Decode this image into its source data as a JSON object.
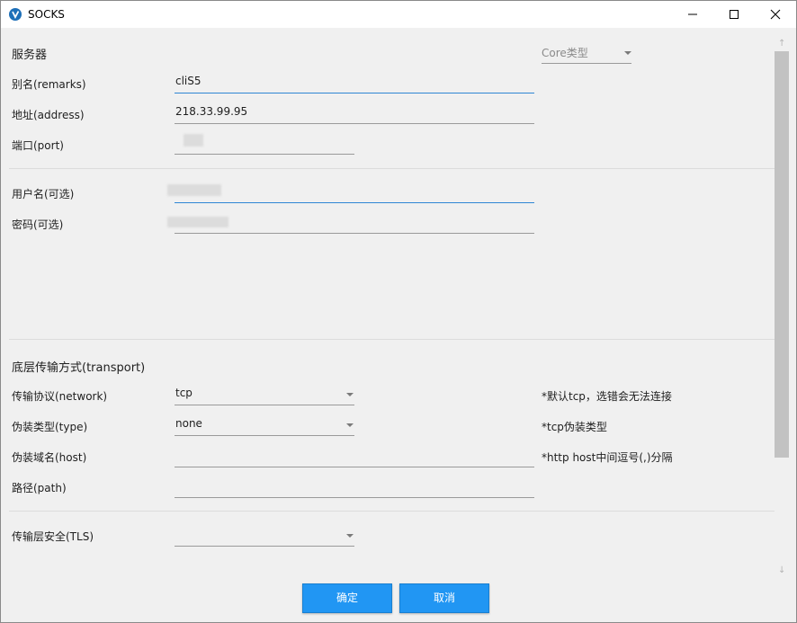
{
  "window": {
    "title": "SOCKS"
  },
  "server": {
    "section_title": "服务器",
    "core_type_placeholder": "Core类型",
    "remarks_label": "别名(remarks)",
    "remarks_value": "cliS5",
    "address_label": "地址(address)",
    "address_value": "218.33.99.95",
    "port_label": "端口(port)",
    "username_label": "用户名(可选)",
    "password_label": "密码(可选)"
  },
  "transport": {
    "section_title": "底层传输方式(transport)",
    "network_label": "传输协议(network)",
    "network_value": "tcp",
    "network_note": "*默认tcp，选错会无法连接",
    "type_label": "伪装类型(type)",
    "type_value": "none",
    "type_note": "*tcp伪装类型",
    "host_label": "伪装域名(host)",
    "host_value": "",
    "host_note": "*http host中间逗号(,)分隔",
    "path_label": "路径(path)",
    "path_value": ""
  },
  "tls": {
    "label": "传输层安全(TLS)",
    "value": ""
  },
  "buttons": {
    "ok": "确定",
    "cancel": "取消"
  },
  "colors": {
    "accent": "#2196f3",
    "focus_underline": "#2f86d4",
    "background": "#f0f0f0"
  }
}
